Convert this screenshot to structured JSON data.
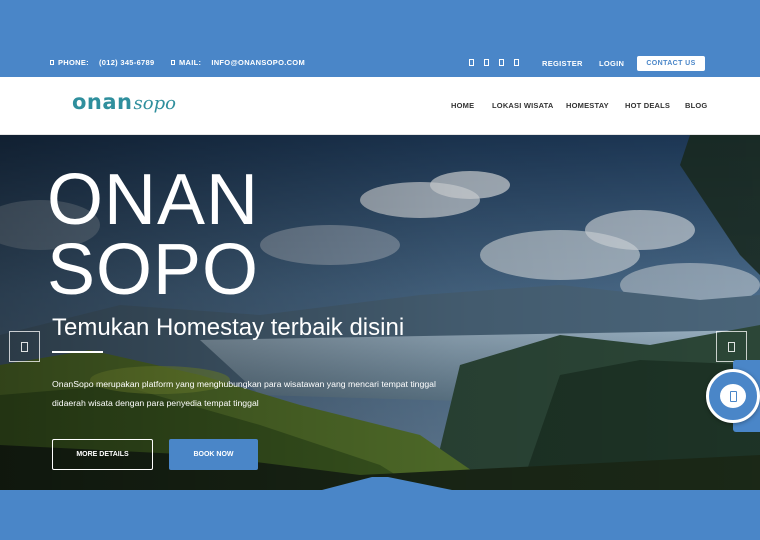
{
  "topbar": {
    "phone_label": "PHONE:",
    "phone_value": "(012) 345-6789",
    "mail_label": "MAIL:",
    "mail_value": "INFO@ONANSOPO.COM",
    "social_icons": [
      "social-icon-1",
      "social-icon-2",
      "social-icon-3",
      "social-icon-4"
    ],
    "register": "REGISTER",
    "login": "LOGIN",
    "contact": "CONTACT US"
  },
  "logo": {
    "part1": "onan",
    "part2": "sopo"
  },
  "nav": {
    "items": [
      "HOME",
      "LOKASI WISATA",
      "HOMESTAY",
      "HOT DEALS",
      "BLOG"
    ]
  },
  "hero": {
    "title_line1": "ONAN",
    "title_line2": "SOPO",
    "subtitle": "Temukan Homestay terbaik disini",
    "description": "OnanSopo merupakan platform yang menghubungkan para wisatawan yang mencari tempat tinggal didaerah wisata dengan para penyedia tempat tinggal",
    "more_button": "MORE DETAILS",
    "book_button": "BOOK NOW"
  },
  "colors": {
    "brand": "#4a86c8",
    "logo": "#2f8f9d",
    "nav_text": "#333333"
  }
}
